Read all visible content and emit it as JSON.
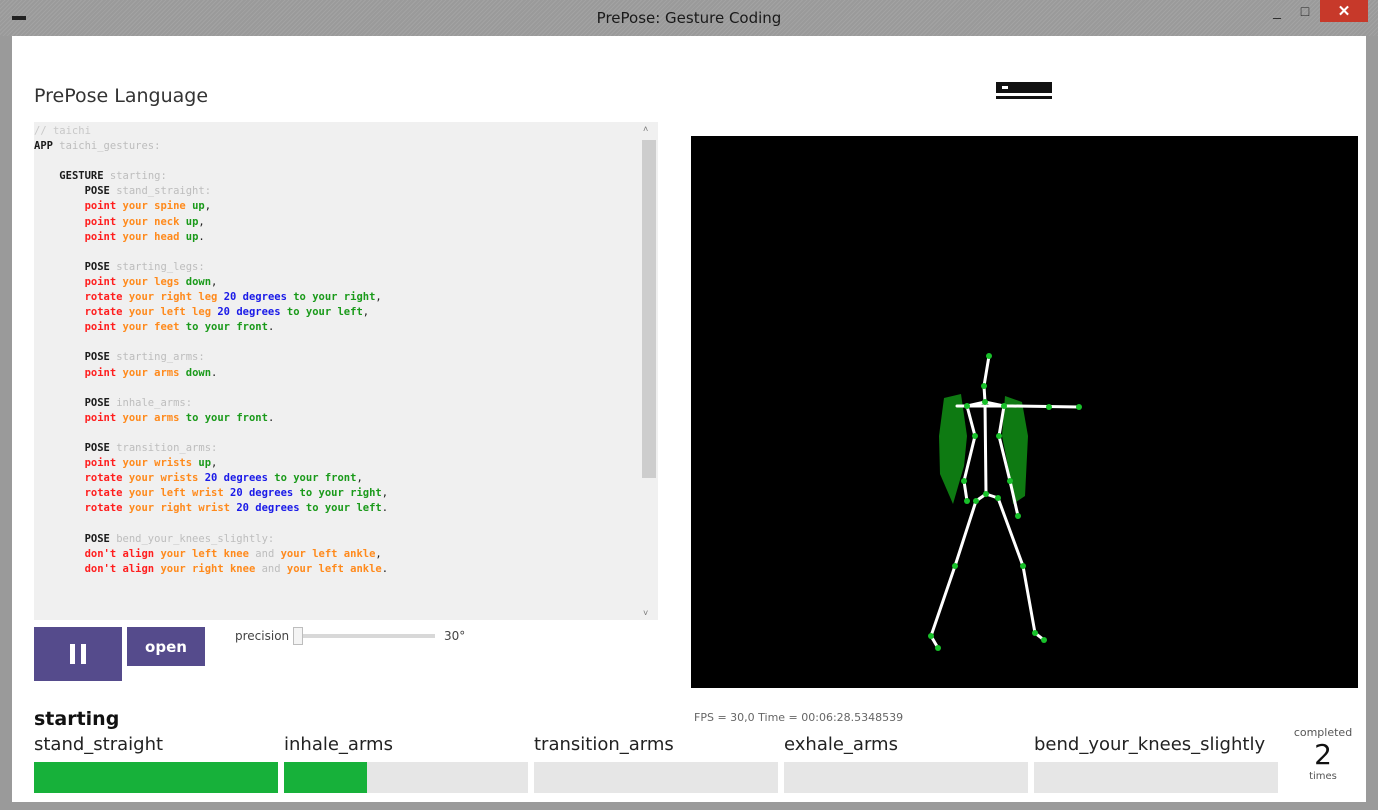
{
  "window": {
    "title": "PrePose: Gesture Coding",
    "minimize_glyph": "_",
    "maximize_glyph": "□",
    "close_glyph": "✕"
  },
  "editor": {
    "heading": "PrePose Language",
    "scroll_up_glyph": "˄",
    "scroll_down_glyph": "˅",
    "lines": [
      [
        [
          "c",
          "// taichi"
        ]
      ],
      [
        [
          "k",
          "APP"
        ],
        [
          "t",
          " "
        ],
        [
          "n",
          "taichi_gestures:"
        ]
      ],
      [],
      [
        [
          "t",
          "    "
        ],
        [
          "k",
          "GESTURE"
        ],
        [
          "t",
          " "
        ],
        [
          "n",
          "starting:"
        ]
      ],
      [
        [
          "t",
          "        "
        ],
        [
          "k",
          "POSE"
        ],
        [
          "t",
          " "
        ],
        [
          "n",
          "stand_straight:"
        ]
      ],
      [
        [
          "t",
          "        "
        ],
        [
          "v",
          "point"
        ],
        [
          "t",
          " "
        ],
        [
          "b",
          "your spine"
        ],
        [
          "t",
          " "
        ],
        [
          "d",
          "up"
        ],
        [
          "t",
          ","
        ]
      ],
      [
        [
          "t",
          "        "
        ],
        [
          "v",
          "point"
        ],
        [
          "t",
          " "
        ],
        [
          "b",
          "your neck"
        ],
        [
          "t",
          " "
        ],
        [
          "d",
          "up"
        ],
        [
          "t",
          ","
        ]
      ],
      [
        [
          "t",
          "        "
        ],
        [
          "v",
          "point"
        ],
        [
          "t",
          " "
        ],
        [
          "b",
          "your head"
        ],
        [
          "t",
          " "
        ],
        [
          "d",
          "up"
        ],
        [
          "t",
          "."
        ]
      ],
      [],
      [
        [
          "t",
          "        "
        ],
        [
          "k",
          "POSE"
        ],
        [
          "t",
          " "
        ],
        [
          "n",
          "starting_legs:"
        ]
      ],
      [
        [
          "t",
          "        "
        ],
        [
          "v",
          "point"
        ],
        [
          "t",
          " "
        ],
        [
          "b",
          "your legs"
        ],
        [
          "t",
          " "
        ],
        [
          "d",
          "down"
        ],
        [
          "t",
          ","
        ]
      ],
      [
        [
          "t",
          "        "
        ],
        [
          "v",
          "rotate"
        ],
        [
          "t",
          " "
        ],
        [
          "b",
          "your right leg"
        ],
        [
          "t",
          " "
        ],
        [
          "u",
          "20 degrees"
        ],
        [
          "t",
          " "
        ],
        [
          "d",
          "to your right"
        ],
        [
          "t",
          ","
        ]
      ],
      [
        [
          "t",
          "        "
        ],
        [
          "v",
          "rotate"
        ],
        [
          "t",
          " "
        ],
        [
          "b",
          "your left leg"
        ],
        [
          "t",
          " "
        ],
        [
          "u",
          "20 degrees"
        ],
        [
          "t",
          " "
        ],
        [
          "d",
          "to your left"
        ],
        [
          "t",
          ","
        ]
      ],
      [
        [
          "t",
          "        "
        ],
        [
          "v",
          "point"
        ],
        [
          "t",
          " "
        ],
        [
          "b",
          "your feet"
        ],
        [
          "t",
          " "
        ],
        [
          "d",
          "to your front"
        ],
        [
          "t",
          "."
        ]
      ],
      [],
      [
        [
          "t",
          "        "
        ],
        [
          "k",
          "POSE"
        ],
        [
          "t",
          " "
        ],
        [
          "n",
          "starting_arms:"
        ]
      ],
      [
        [
          "t",
          "        "
        ],
        [
          "v",
          "point"
        ],
        [
          "t",
          " "
        ],
        [
          "b",
          "your arms"
        ],
        [
          "t",
          " "
        ],
        [
          "d",
          "down"
        ],
        [
          "t",
          "."
        ]
      ],
      [],
      [
        [
          "t",
          "        "
        ],
        [
          "k",
          "POSE"
        ],
        [
          "t",
          " "
        ],
        [
          "n",
          "inhale_arms:"
        ]
      ],
      [
        [
          "t",
          "        "
        ],
        [
          "v",
          "point"
        ],
        [
          "t",
          " "
        ],
        [
          "b",
          "your arms"
        ],
        [
          "t",
          " "
        ],
        [
          "d",
          "to your front"
        ],
        [
          "t",
          "."
        ]
      ],
      [],
      [
        [
          "t",
          "        "
        ],
        [
          "k",
          "POSE"
        ],
        [
          "t",
          " "
        ],
        [
          "n",
          "transition_arms:"
        ]
      ],
      [
        [
          "t",
          "        "
        ],
        [
          "v",
          "point"
        ],
        [
          "t",
          " "
        ],
        [
          "b",
          "your wrists"
        ],
        [
          "t",
          " "
        ],
        [
          "d",
          "up"
        ],
        [
          "t",
          ","
        ]
      ],
      [
        [
          "t",
          "        "
        ],
        [
          "v",
          "rotate"
        ],
        [
          "t",
          " "
        ],
        [
          "b",
          "your wrists"
        ],
        [
          "t",
          " "
        ],
        [
          "u",
          "20 degrees"
        ],
        [
          "t",
          " "
        ],
        [
          "d",
          "to your front"
        ],
        [
          "t",
          ","
        ]
      ],
      [
        [
          "t",
          "        "
        ],
        [
          "v",
          "rotate"
        ],
        [
          "t",
          " "
        ],
        [
          "b",
          "your left wrist"
        ],
        [
          "t",
          " "
        ],
        [
          "u",
          "20 degrees"
        ],
        [
          "t",
          " "
        ],
        [
          "d",
          "to your right"
        ],
        [
          "t",
          ","
        ]
      ],
      [
        [
          "t",
          "        "
        ],
        [
          "v",
          "rotate"
        ],
        [
          "t",
          " "
        ],
        [
          "b",
          "your right wrist"
        ],
        [
          "t",
          " "
        ],
        [
          "u",
          "20 degrees"
        ],
        [
          "t",
          " "
        ],
        [
          "d",
          "to your left"
        ],
        [
          "t",
          "."
        ]
      ],
      [],
      [
        [
          "t",
          "        "
        ],
        [
          "k",
          "POSE"
        ],
        [
          "t",
          " "
        ],
        [
          "n",
          "bend_your_knees_slightly:"
        ]
      ],
      [
        [
          "t",
          "        "
        ],
        [
          "v",
          "don't align"
        ],
        [
          "t",
          " "
        ],
        [
          "b",
          "your left knee"
        ],
        [
          "t",
          " "
        ],
        [
          "n",
          "and"
        ],
        [
          "t",
          " "
        ],
        [
          "b",
          "your left ankle"
        ],
        [
          "t",
          ","
        ]
      ],
      [
        [
          "t",
          "        "
        ],
        [
          "v",
          "don't align"
        ],
        [
          "t",
          " "
        ],
        [
          "b",
          "your right knee"
        ],
        [
          "t",
          " "
        ],
        [
          "n",
          "and"
        ],
        [
          "t",
          " "
        ],
        [
          "b",
          "your left ankle"
        ],
        [
          "t",
          "."
        ]
      ]
    ]
  },
  "controls": {
    "open_label": "open",
    "precision_label": "precision",
    "precision_value": "30°",
    "precision_fraction": 0.0
  },
  "viewer": {
    "fps_text": "FPS = 30,0 Time = 00:06:28.5348539"
  },
  "progress": {
    "gesture": "starting",
    "stages": [
      {
        "label": "stand_straight",
        "fill": 1.0
      },
      {
        "label": "inhale_arms",
        "fill": 0.34
      },
      {
        "label": "transition_arms",
        "fill": 0.0
      },
      {
        "label": "exhale_arms",
        "fill": 0.0
      },
      {
        "label": "bend_your_knees_slightly",
        "fill": 0.0
      }
    ],
    "completed_label": "completed",
    "completed_count": "2",
    "times_label": "times"
  },
  "colors": {
    "accent_button": "#554b8c",
    "progress_fill": "#17b13a",
    "skeleton_bone": "#ffffff",
    "skeleton_joint": "#18c02a",
    "highlight_region": "#0e7a12"
  }
}
